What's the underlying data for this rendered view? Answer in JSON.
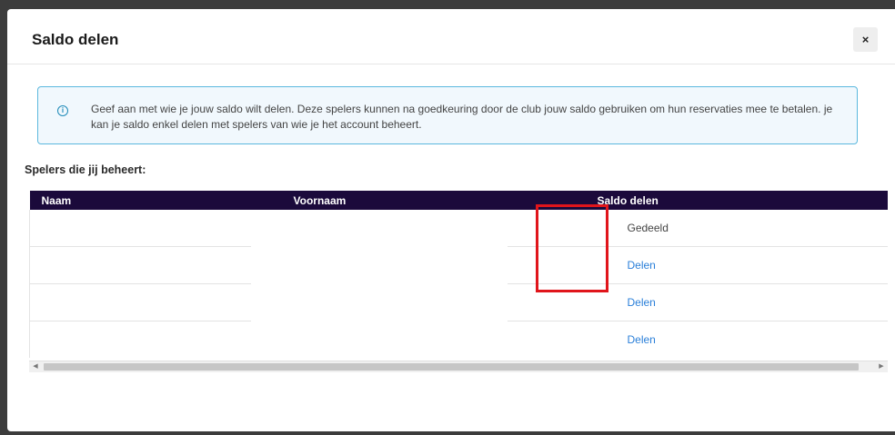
{
  "modal": {
    "title": "Saldo delen",
    "close_label": "×"
  },
  "info": {
    "icon": "info-icon",
    "icon_glyph": "i",
    "text": "Geef aan met wie je jouw saldo wilt delen. Deze spelers kunnen na goedkeuring door de club jouw saldo gebruiken om hun reservaties mee te betalen. je kan je saldo enkel delen met spelers van wie je het account beheert."
  },
  "section_label": "Spelers die jij beheert:",
  "table": {
    "headers": [
      "Naam",
      "Voornaam",
      "Saldo delen"
    ],
    "rows": [
      {
        "naam": "",
        "voornaam": "",
        "saldo": "Gedeeld",
        "is_link": false
      },
      {
        "naam": "",
        "voornaam": "",
        "saldo": "Delen",
        "is_link": true
      },
      {
        "naam": "",
        "voornaam": "",
        "saldo": "Delen",
        "is_link": true
      },
      {
        "naam": "",
        "voornaam": "",
        "saldo": "Delen",
        "is_link": true
      }
    ]
  },
  "scrollbar": {
    "left_arrow": "◀",
    "right_arrow": "▶"
  },
  "colors": {
    "header_bg": "#1b0a3b",
    "link": "#2a7fd9",
    "info_border": "#5bb8de",
    "highlight": "#e0151b"
  }
}
